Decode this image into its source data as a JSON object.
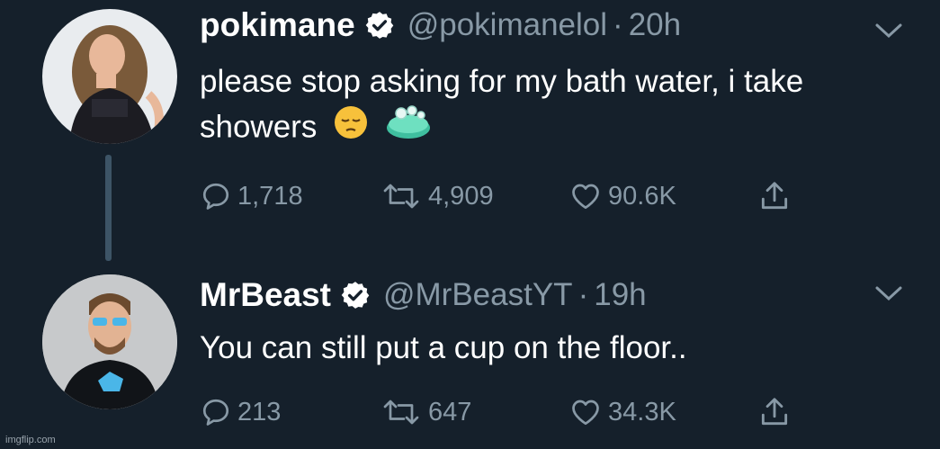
{
  "colors": {
    "background": "#15202b",
    "text_primary": "#ffffff",
    "text_secondary": "#8899a6",
    "verified_badge": "#ffffff"
  },
  "tweets": [
    {
      "display_name": "pokimane",
      "handle": "@pokimanelol",
      "separator": "·",
      "time": "20h",
      "text": "please stop asking for my bath water, i take showers",
      "emojis": [
        "pensive-face-emoji",
        "soap-emoji"
      ],
      "replies": "1,718",
      "retweets": "4,909",
      "likes": "90.6K",
      "icons": [
        "reply-icon",
        "retweet-icon",
        "like-icon",
        "share-icon",
        "chevron-down-icon",
        "verified-icon"
      ]
    },
    {
      "display_name": "MrBeast",
      "handle": "@MrBeastYT",
      "separator": "·",
      "time": "19h",
      "text": "You can still put a cup on the floor..",
      "replies": "213",
      "retweets": "647",
      "likes": "34.3K",
      "icons": [
        "reply-icon",
        "retweet-icon",
        "like-icon",
        "share-icon",
        "chevron-down-icon",
        "verified-icon"
      ]
    }
  ],
  "watermark": "imgflip.com"
}
